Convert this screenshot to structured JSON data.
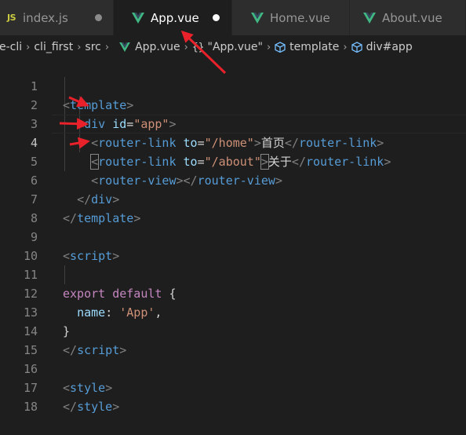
{
  "tabs": [
    {
      "label": "index.js",
      "icon": "js-icon",
      "active": false,
      "modified": true
    },
    {
      "label": "App.vue",
      "icon": "vue-icon",
      "active": true,
      "modified": true
    },
    {
      "label": "Home.vue",
      "icon": "vue-icon",
      "active": false,
      "modified": false
    },
    {
      "label": "About.vue",
      "icon": "vue-icon",
      "active": false,
      "modified": false
    }
  ],
  "breadcrumb": {
    "items": [
      "e-cli",
      "cli_first",
      "src",
      "App.vue",
      "\"App.vue\"",
      "template",
      "div#app"
    ],
    "braces": "{}"
  },
  "editor": {
    "current_line": 4,
    "lines": [
      {
        "n": "1"
      },
      {
        "n": "2"
      },
      {
        "n": "3"
      },
      {
        "n": "4"
      },
      {
        "n": "5"
      },
      {
        "n": "6"
      },
      {
        "n": "7"
      },
      {
        "n": "8"
      },
      {
        "n": "9"
      },
      {
        "n": "10"
      },
      {
        "n": "11"
      },
      {
        "n": "12"
      },
      {
        "n": "13"
      },
      {
        "n": "14"
      },
      {
        "n": "15"
      },
      {
        "n": "16"
      },
      {
        "n": "17"
      },
      {
        "n": "18"
      }
    ],
    "code": {
      "l1_tag": "template",
      "l2_tag": "div",
      "l2_attr": "id",
      "l2_val": "\"app\"",
      "l3_tag": "router-link",
      "l3_attr": "to",
      "l3_val": "\"/home\"",
      "l3_text": "首页",
      "l3_close": "router-link",
      "l4_tag": "router-link",
      "l4_attr": "to",
      "l4_val": "\"/about\"",
      "l4_text": "关于",
      "l4_close": "router-link",
      "l5_tag": "router-view",
      "l5_close": "router-view",
      "l6_close": "div",
      "l7_close": "template",
      "l9_tag": "script",
      "l11_kw1": "export",
      "l11_kw2": "default",
      "l11_brace": "{",
      "l12_prop": "name",
      "l12_val": "'App'",
      "l12_comma": ",",
      "l13_brace": "}",
      "l14_close": "script",
      "l16_tag": "style",
      "l17_close": "style"
    }
  },
  "colors": {
    "annotation_arrow": "#e8212a",
    "vue_green": "#41b883",
    "js_yellow": "#cbcb41"
  }
}
